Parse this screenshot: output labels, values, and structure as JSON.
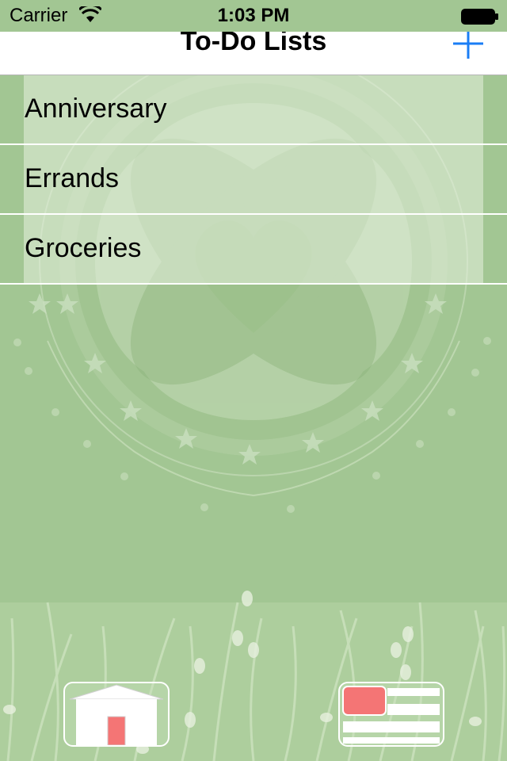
{
  "status_bar": {
    "carrier": "Carrier",
    "time": "1:03 PM",
    "wifi_icon": "wifi-icon",
    "battery_icon": "battery-icon"
  },
  "nav_bar": {
    "title": "To-Do Lists",
    "add_icon": "plus-icon"
  },
  "lists": [
    {
      "label": "Anniversary"
    },
    {
      "label": "Errands"
    },
    {
      "label": "Groceries"
    }
  ],
  "bottom_buttons": {
    "home_icon": "house-icon",
    "list_icon": "list-view-icon"
  },
  "colors": {
    "background": "#a2c693",
    "accent": "#1a7df5",
    "icon_red": "#f47575"
  }
}
